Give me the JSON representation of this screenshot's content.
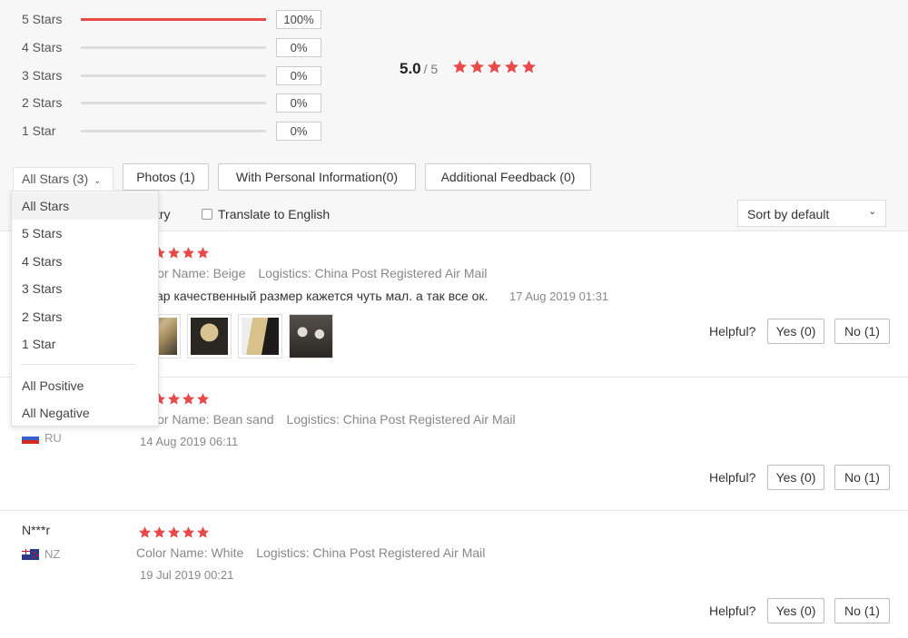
{
  "rating_distribution": [
    {
      "label": "5 Stars",
      "percent_text": "100%",
      "fill": 1.0
    },
    {
      "label": "4 Stars",
      "percent_text": "0%",
      "fill": 0
    },
    {
      "label": "3 Stars",
      "percent_text": "0%",
      "fill": 0
    },
    {
      "label": "2 Stars",
      "percent_text": "0%",
      "fill": 0
    },
    {
      "label": "1 Star",
      "percent_text": "0%",
      "fill": 0
    }
  ],
  "average": {
    "value": "5.0",
    "total": "/ 5",
    "stars": 5
  },
  "filters": {
    "stars_select": "All Stars (3)",
    "photos": "Photos (1)",
    "personal_info": "With Personal Information(0)",
    "additional": "Additional Feedback (0)"
  },
  "toolbar": {
    "country_label": "try",
    "translate_label": "Translate to English",
    "sort_label": "Sort by default"
  },
  "dropdown": {
    "items": [
      "All Stars",
      "5 Stars",
      "4 Stars",
      "3 Stars",
      "2 Stars",
      "1 Star"
    ],
    "extra_items": [
      "All Positive",
      "All Negative"
    ],
    "active": "All Stars"
  },
  "reviews": [
    {
      "name": "",
      "country": "",
      "stars": 5,
      "color": "lor Name: Beige",
      "logistics": "Logistics: China Post Registered Air Mail",
      "text": "ар качественный размер кажется чуть мал. а так все ок.",
      "date": "17 Aug 2019 01:31",
      "helpful": "Helpful?",
      "yes": "Yes (0)",
      "no": "No (1)"
    },
    {
      "name": "",
      "country": "RU",
      "stars": 5,
      "color": "lor Name: Bean sand",
      "logistics": "Logistics: China Post Registered Air Mail",
      "text": "",
      "date": "14 Aug 2019 06:11",
      "helpful": "Helpful?",
      "yes": "Yes (0)",
      "no": "No (1)"
    },
    {
      "name": "N***r",
      "country": "NZ",
      "stars": 5,
      "color": "Color Name: White",
      "logistics": "Logistics: China Post Registered Air Mail",
      "text": "",
      "date": "19 Jul 2019 00:21",
      "helpful": "Helpful?",
      "yes": "Yes (0)",
      "no": "No (1)"
    }
  ],
  "colors": {
    "accent": "#e84a4a",
    "panel": "#f7f7f7"
  },
  "icons": [
    "star-icon",
    "chevron-down-icon",
    "checkbox-icon",
    "flag-ru-icon",
    "flag-nz-icon"
  ]
}
